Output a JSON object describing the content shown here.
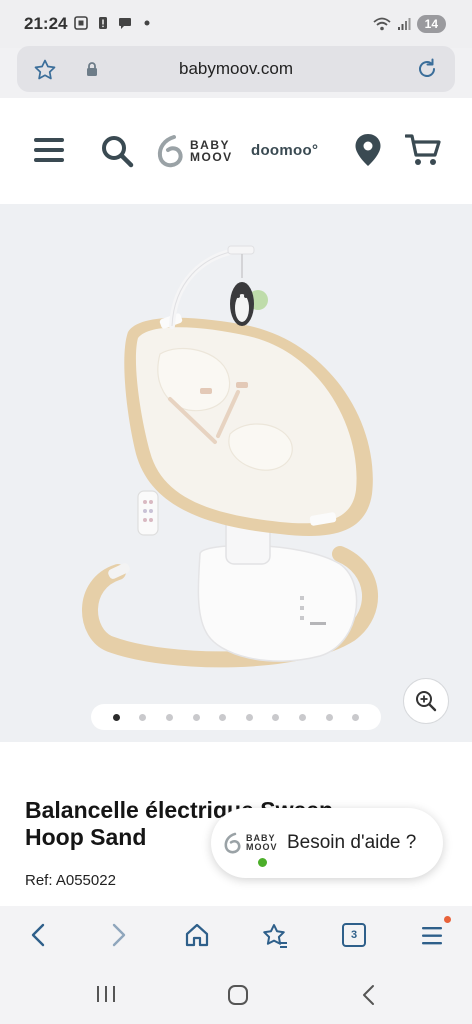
{
  "status_bar": {
    "time": "21:24",
    "battery_level": "14"
  },
  "browser": {
    "url": "babymoov.com",
    "tab_count": "3"
  },
  "header": {
    "logo_line1": "BABY",
    "logo_line2": "MOOV",
    "partner_logo": "doomoo°",
    "icons": [
      "menu-icon",
      "search-icon",
      "location-pin-icon",
      "cart-icon"
    ]
  },
  "gallery": {
    "total_slides": 10,
    "active_slide": 1
  },
  "product": {
    "title_line1": "Balancelle électrique Sweep",
    "title_line2": "Hoop Sand",
    "ref": "Ref: A055022"
  },
  "help_widget": {
    "logo_line1": "BABY",
    "logo_line2": "MOOV",
    "label": "Besoin d'aide ?"
  },
  "colors": {
    "brand_dark": "#3a4a52",
    "accent_orange": "#e8623a",
    "online_green": "#4caf2a",
    "wood": "#e6cfa8"
  }
}
